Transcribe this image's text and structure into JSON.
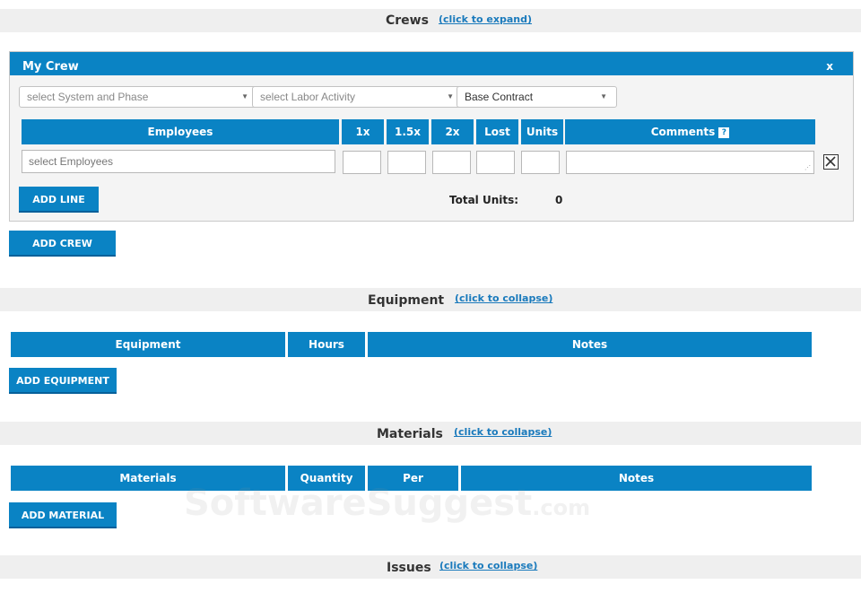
{
  "crews": {
    "title": "Crews",
    "toggle_link": "(click to expand)"
  },
  "crew_panel": {
    "title": "My Crew",
    "close_label": "x",
    "system_phase_select": "select System and Phase",
    "labor_activity_select": "select Labor Activity",
    "contract_select": "Base Contract",
    "columns": {
      "employees": "Employees",
      "one_x": "1x",
      "one_five_x": "1.5x",
      "two_x": "2x",
      "lost": "Lost",
      "units": "Units",
      "comments": "Comments",
      "comments_help": "?"
    },
    "employees_placeholder": "select Employees",
    "add_line_label": "ADD LINE",
    "total_units_label": "Total Units:",
    "total_units_value": "0"
  },
  "add_crew_label": "ADD CREW",
  "equipment": {
    "title": "Equipment",
    "toggle_link": "(click to collapse)",
    "columns": [
      "Equipment",
      "Hours",
      "Notes"
    ],
    "add_label": "ADD EQUIPMENT"
  },
  "materials": {
    "title": "Materials",
    "toggle_link": "(click to collapse)",
    "columns": [
      "Materials",
      "Quantity",
      "Per",
      "Notes"
    ],
    "add_label": "ADD MATERIAL"
  },
  "issues": {
    "title": "Issues",
    "toggle_link": "(click to collapse)"
  },
  "watermark": {
    "main": "SoftwareSuggest",
    "suffix": ".com"
  },
  "colors": {
    "accent": "#0a83c4",
    "link": "#1a7abc",
    "section_bar": "#efefef"
  },
  "icons": {
    "dropdown": "chevron-down-icon",
    "help": "question-icon",
    "remove": "close-box-icon",
    "resize": "resize-grip-icon"
  }
}
